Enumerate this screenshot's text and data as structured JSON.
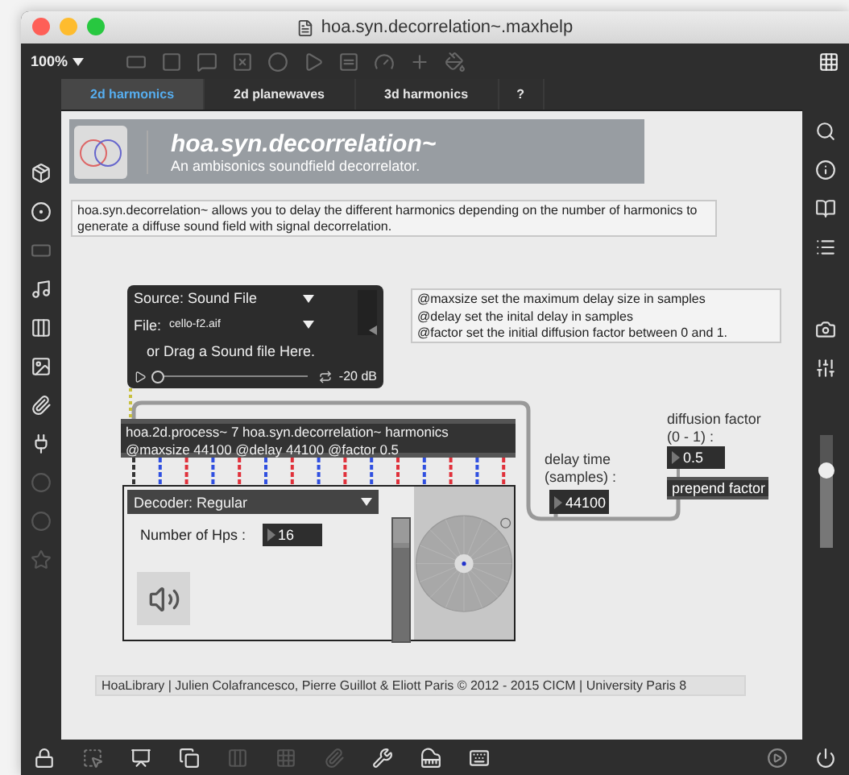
{
  "window": {
    "title": "hoa.syn.decorrelation~.maxhelp"
  },
  "toolbar": {
    "zoom": "100%"
  },
  "tabs": [
    {
      "label": "2d harmonics",
      "selected": true
    },
    {
      "label": "2d planewaves",
      "selected": false
    },
    {
      "label": "3d harmonics",
      "selected": false
    },
    {
      "label": "?",
      "selected": false
    }
  ],
  "header": {
    "title": "hoa.syn.decorrelation~",
    "subtitle": "An ambisonics soundfield decorrelator."
  },
  "description": "hoa.syn.decorrelation~ allows you to delay the different harmonics depending on the number of harmonics to generate a diffuse sound field with signal decorrelation.",
  "playlist": {
    "source": "Source: Sound File",
    "file_label": "File:",
    "file": "cello-f2.aif",
    "hint": "or Drag a Sound file Here.",
    "gain": "-20 dB",
    "level": 0
  },
  "attributes": [
    "@maxsize set the maximum delay size in samples",
    "@delay set the inital delay in samples",
    "@factor set the initial diffusion factor between 0 and 1."
  ],
  "process_object": {
    "line1": "hoa.2d.process~ 7 hoa.syn.decorrelation~ harmonics",
    "line2": "@maxsize 44100 @delay 44100 @factor 0.5"
  },
  "outlet_cords": [
    {
      "color": "#333333"
    },
    {
      "color": "#2f4fe0"
    },
    {
      "color": "#e0303a"
    },
    {
      "color": "#2f4fe0"
    },
    {
      "color": "#e0303a"
    },
    {
      "color": "#2f4fe0"
    },
    {
      "color": "#e0303a"
    },
    {
      "color": "#2f4fe0"
    },
    {
      "color": "#e0303a"
    },
    {
      "color": "#2f4fe0"
    },
    {
      "color": "#e0303a"
    },
    {
      "color": "#2f4fe0"
    },
    {
      "color": "#e0303a"
    },
    {
      "color": "#2f4fe0"
    },
    {
      "color": "#e0303a"
    }
  ],
  "decoder": {
    "mode": "Decoder: Regular",
    "hps_label": "Number of Hps :",
    "hps": "16",
    "level": 0.8
  },
  "delay": {
    "label": "delay time (samples) :",
    "value": "44100"
  },
  "diffusion": {
    "label": "diffusion factor (0 - 1) :",
    "value": "0.5",
    "message": "prepend factor"
  },
  "footer": "HoaLibrary | Julien Colafrancesco, Pierre Guillot & Eliott Paris © 2012 - 2015 CICM | University Paris 8"
}
